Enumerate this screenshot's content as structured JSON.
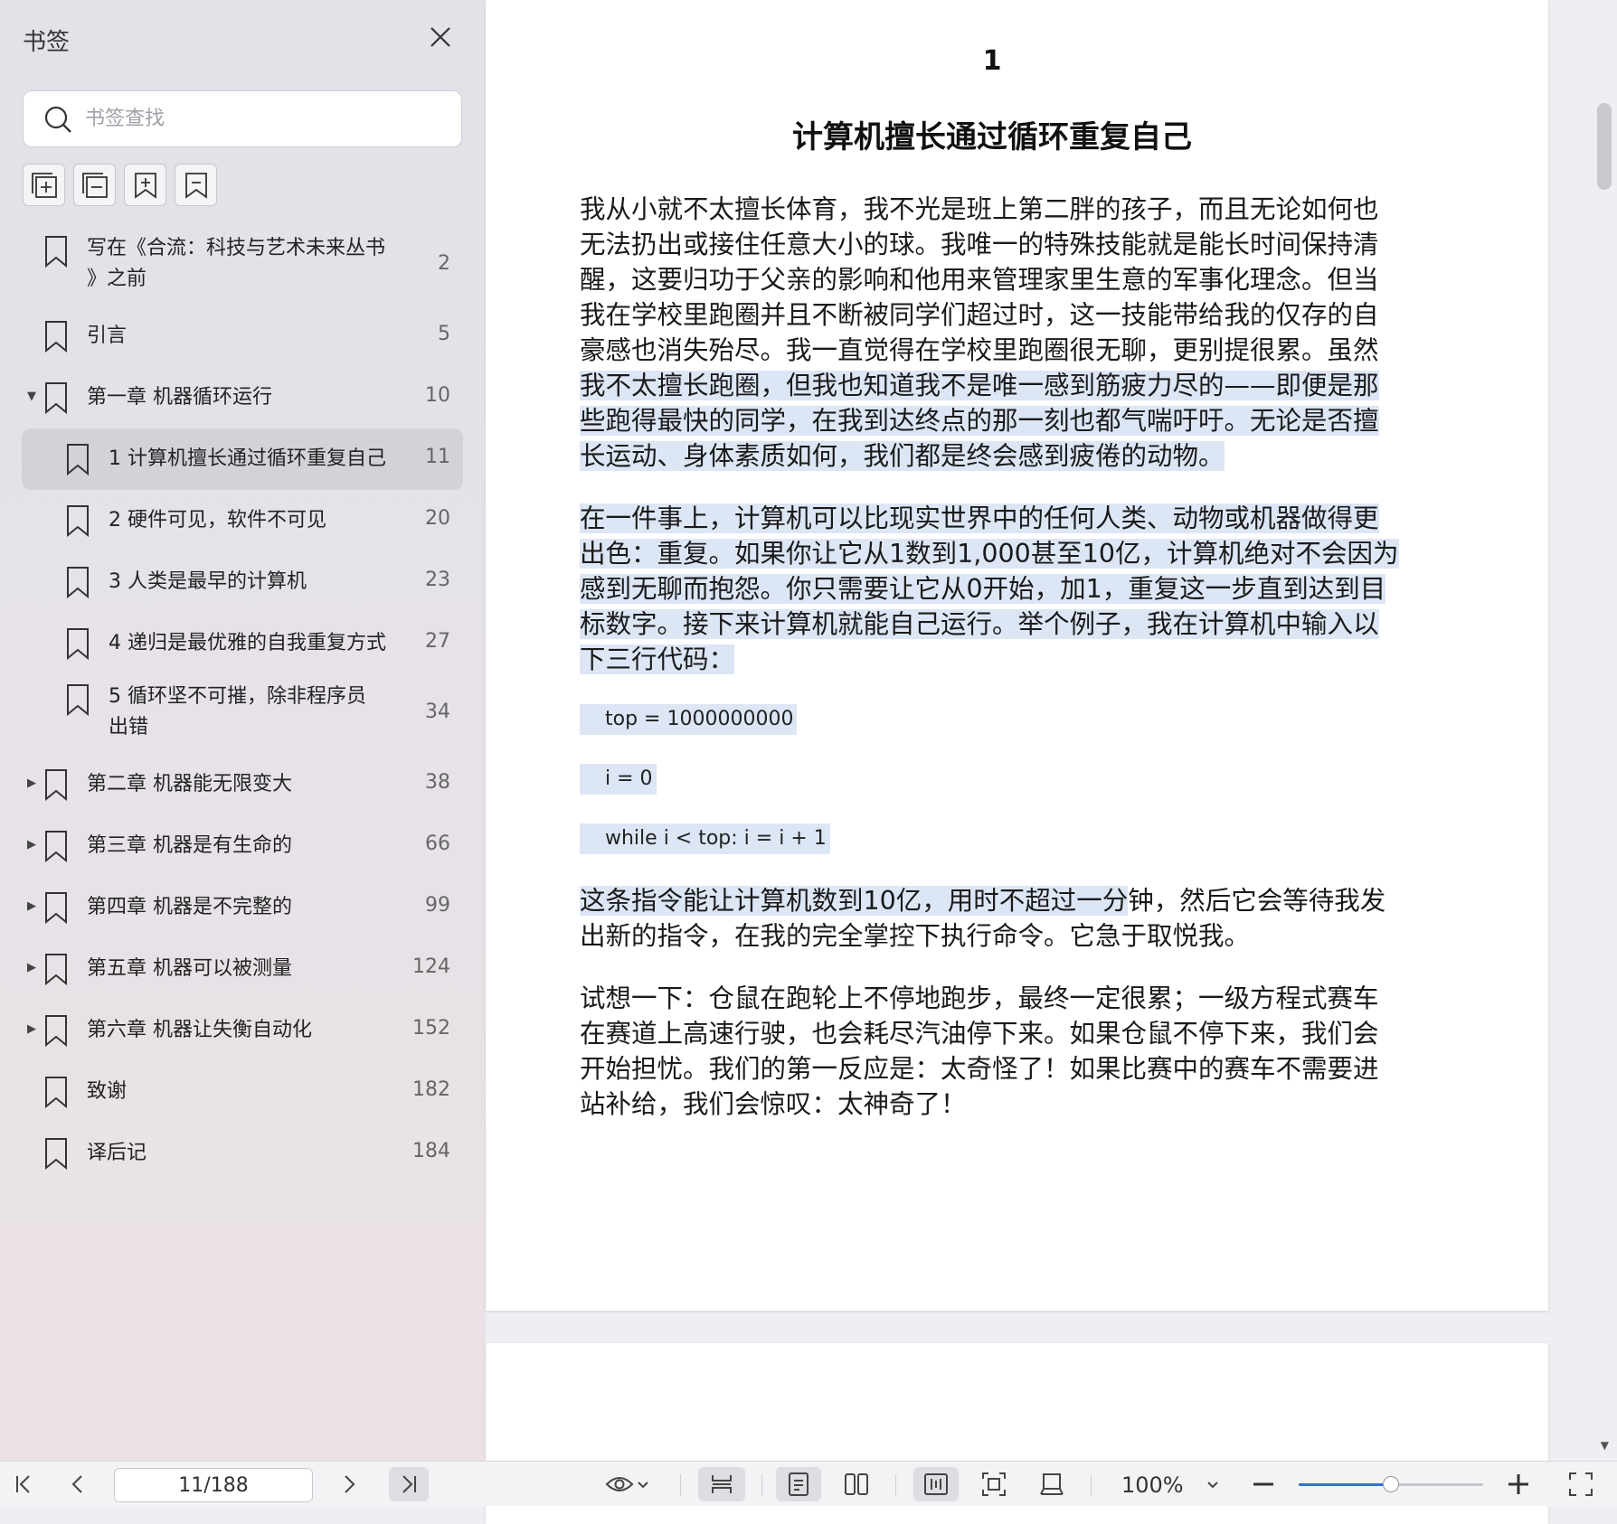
{
  "sidebar": {
    "title": "书签",
    "search_placeholder": "书签查找",
    "items": [
      {
        "label": "写在《合流：科技与艺术未来丛书",
        "label2": "》之前",
        "page": "2",
        "level": 0,
        "expand": ""
      },
      {
        "label": "引言",
        "page": "5",
        "level": 0,
        "expand": ""
      },
      {
        "label": "第一章 机器循环运行",
        "page": "10",
        "level": 0,
        "expand": "▼"
      },
      {
        "label": "1 计算机擅长通过循环重复自己",
        "page": "11",
        "level": 1,
        "expand": "",
        "active": true
      },
      {
        "label": "2 硬件可见，软件不可见",
        "page": "20",
        "level": 1,
        "expand": ""
      },
      {
        "label": "3 人类是最早的计算机",
        "page": "23",
        "level": 1,
        "expand": ""
      },
      {
        "label": "4 递归是最优雅的自我重复方式",
        "page": "27",
        "level": 1,
        "expand": ""
      },
      {
        "label": "5 循环坚不可摧，除非程序员",
        "label2": "出错",
        "page": "34",
        "level": 1,
        "expand": ""
      },
      {
        "label": "第二章 机器能无限变大",
        "page": "38",
        "level": 0,
        "expand": "▶"
      },
      {
        "label": "第三章 机器是有生命的",
        "page": "66",
        "level": 0,
        "expand": "▶"
      },
      {
        "label": "第四章 机器是不完整的",
        "page": "99",
        "level": 0,
        "expand": "▶"
      },
      {
        "label": "第五章 机器可以被测量",
        "page": "124",
        "level": 0,
        "expand": "▶"
      },
      {
        "label": "第六章 机器让失衡自动化",
        "page": "152",
        "level": 0,
        "expand": "▶"
      },
      {
        "label": "致谢",
        "page": "182",
        "level": 0,
        "expand": ""
      },
      {
        "label": "译后记",
        "page": "184",
        "level": 0,
        "expand": ""
      }
    ]
  },
  "document": {
    "chapter_number": "1",
    "chapter_title": "计算机擅长通过循环重复自己",
    "para1_plain": "我从小就不太擅长体育，我不光是班上第二胖的孩子，而且无论如何也无法扔出或接住任意大小的球。我唯一的特殊技能就是能长时间保持清醒，这要归功于父亲的影响和他用来管理家里生意的军事化理念。但当我在学校里跑圈并且不断被同学们超过时，这一技能带给我的仅存的自豪感也消失殆尽。我一直觉得在学校里跑圈很无聊，更别提很累。虽然",
    "para1_highlight": "我不太擅长跑圈，但我也知道我不是唯一感到筋疲力尽的——即便是那些跑得最快的同学，在我到达终点的那一刻也都气喘吁吁。无论是否擅长运动、身体素质如何，我们都是终会感到疲倦的动物。",
    "para2_highlight": "在一件事上，计算机可以比现实世界中的任何人类、动物或机器做得更出色：重复。如果你让它从1数到1,000甚至10亿，计算机绝对不会因为感到无聊而抱怨。你只需要让它从0开始，加1，重复这一步直到达到目标数字。接下来计算机就能自己运行。举个例子，我在计算机中输入以下三行代码：",
    "code": [
      "top = 1000000000",
      "i = 0",
      "while i < top: i = i + 1"
    ],
    "para3_highlight": "这条指令能让计算机数到10亿，用时不超过一分",
    "para3_plain": "钟，然后它会等待我发出新的指令，在我的完全掌控下执行命令。它急于取悦我。",
    "para4_plain": "试想一下：仓鼠在跑轮上不停地跑步，最终一定很累；一级方程式赛车在赛道上高速行驶，也会耗尽汽油停下来。如果仓鼠不停下来，我们会开始担忧。我们的第一反应是：太奇怪了！如果比赛中的赛车不需要进站补给，我们会惊叹：太神奇了！"
  },
  "toolbar": {
    "page_indicator": "11/188",
    "zoom_label": "100%",
    "zoom_level": 0.5
  },
  "colors": {
    "highlight": "#dde6f5",
    "accent": "#2d6fe0"
  }
}
